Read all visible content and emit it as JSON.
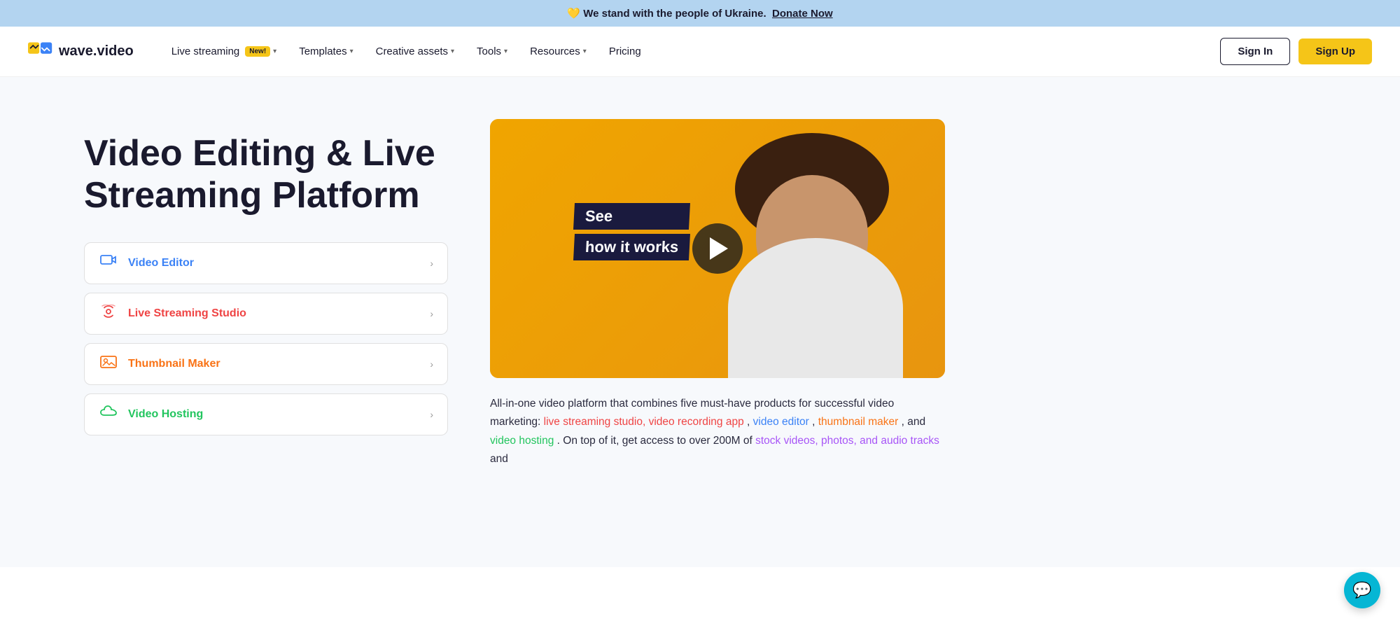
{
  "banner": {
    "heart": "💛",
    "text": "We stand with the people of Ukraine.",
    "link_text": "Donate Now"
  },
  "navbar": {
    "logo_text": "wave.video",
    "nav_items": [
      {
        "label": "Live streaming",
        "badge": "New!",
        "has_chevron": true
      },
      {
        "label": "Templates",
        "has_chevron": true
      },
      {
        "label": "Creative assets",
        "has_chevron": true
      },
      {
        "label": "Tools",
        "has_chevron": true
      },
      {
        "label": "Resources",
        "has_chevron": true
      },
      {
        "label": "Pricing",
        "has_chevron": false
      }
    ],
    "signin_label": "Sign In",
    "signup_label": "Sign Up"
  },
  "hero": {
    "title": "Video Editing & Live Streaming Platform",
    "features": [
      {
        "id": "video-editor",
        "label": "Video Editor",
        "color_class": "video"
      },
      {
        "id": "live-streaming",
        "label": "Live Streaming Studio",
        "color_class": "live"
      },
      {
        "id": "thumbnail-maker",
        "label": "Thumbnail Maker",
        "color_class": "thumb"
      },
      {
        "id": "video-hosting",
        "label": "Video Hosting",
        "color_class": "hosting"
      }
    ],
    "video": {
      "see_line1": "See",
      "see_line2": "how it works"
    },
    "description_parts": [
      "All-in-one video platform that combines five must-have products for successful video marketing: ",
      "live streaming studio, video recording app",
      ", ",
      "video editor",
      ", ",
      "thumbnail maker",
      ", and ",
      "video hosting",
      ". On top of it, get access to over 200M of ",
      "stock videos, photos, and audio tracks",
      " and"
    ]
  }
}
